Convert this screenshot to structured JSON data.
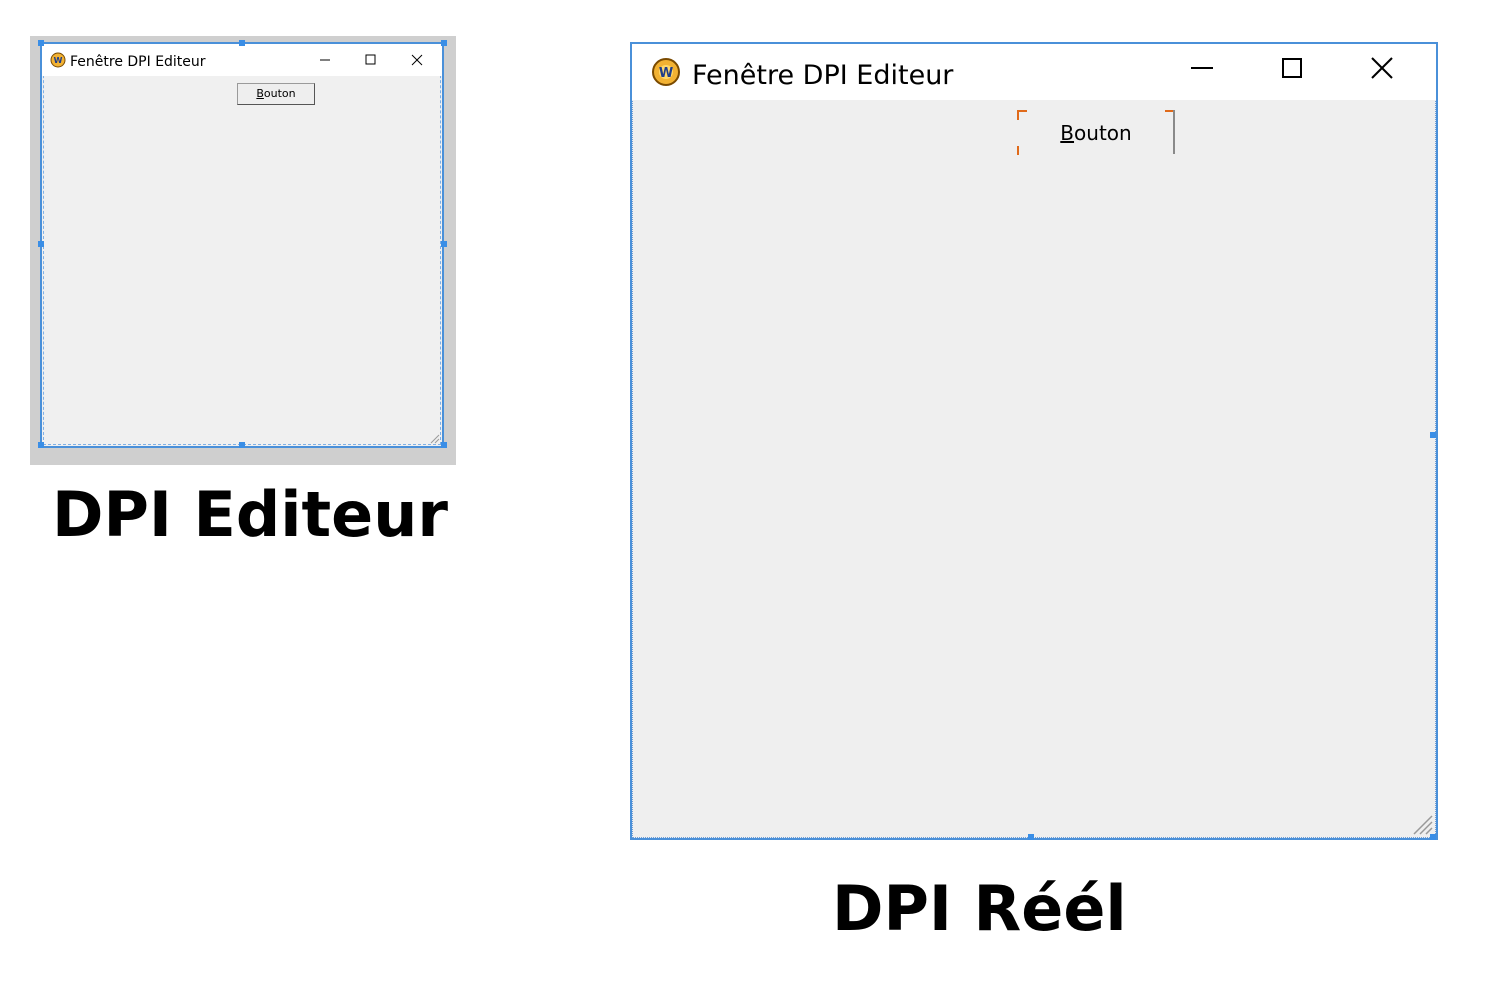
{
  "editor": {
    "window": {
      "title": "Fenêtre DPI Editeur",
      "button_label": "Bouton",
      "controls": [
        "minimize-icon",
        "maximize-icon",
        "close-icon"
      ]
    },
    "caption": "DPI Editeur"
  },
  "real": {
    "window": {
      "title": "Fenêtre DPI Editeur",
      "button_label": "Bouton",
      "controls": [
        "minimize-icon",
        "maximize-icon",
        "close-icon"
      ]
    },
    "caption": "DPI Réél"
  },
  "colors": {
    "selection_handles": "#3a8ee6",
    "window_border": "#4a90d9",
    "client_bg": "#f0f0f0",
    "focus_corners": "#e06a1a"
  }
}
